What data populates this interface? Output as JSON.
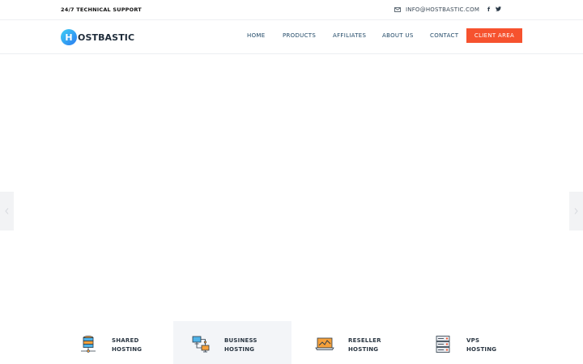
{
  "topbar": {
    "support_text": "24/7 TECHNICAL SUPPORT",
    "email": "INFO@HOSTBASTIC.COM",
    "social": {
      "facebook": "f",
      "twitter": "t"
    }
  },
  "brand": {
    "mark": "H",
    "name": "OSTBASTIC"
  },
  "nav": {
    "items": [
      {
        "label": "HOME"
      },
      {
        "label": "PRODUCTS"
      },
      {
        "label": "AFFILIATES"
      },
      {
        "label": "ABOUT US"
      },
      {
        "label": "CONTACT"
      }
    ],
    "cta": "CLIENT AREA"
  },
  "services": [
    {
      "line1": "SHARED",
      "line2": "HOSTING",
      "icon": "database-icon"
    },
    {
      "line1": "BUSINESS",
      "line2": "HOSTING",
      "icon": "network-icon"
    },
    {
      "line1": "RESELLER",
      "line2": "HOSTING",
      "icon": "laptop-chart-icon"
    },
    {
      "line1": "VPS",
      "line2": "HOSTING",
      "icon": "server-rack-icon"
    }
  ],
  "colors": {
    "accent": "#f6522e",
    "nav_text": "#1f4766",
    "active_bg": "#f3f5f8"
  }
}
